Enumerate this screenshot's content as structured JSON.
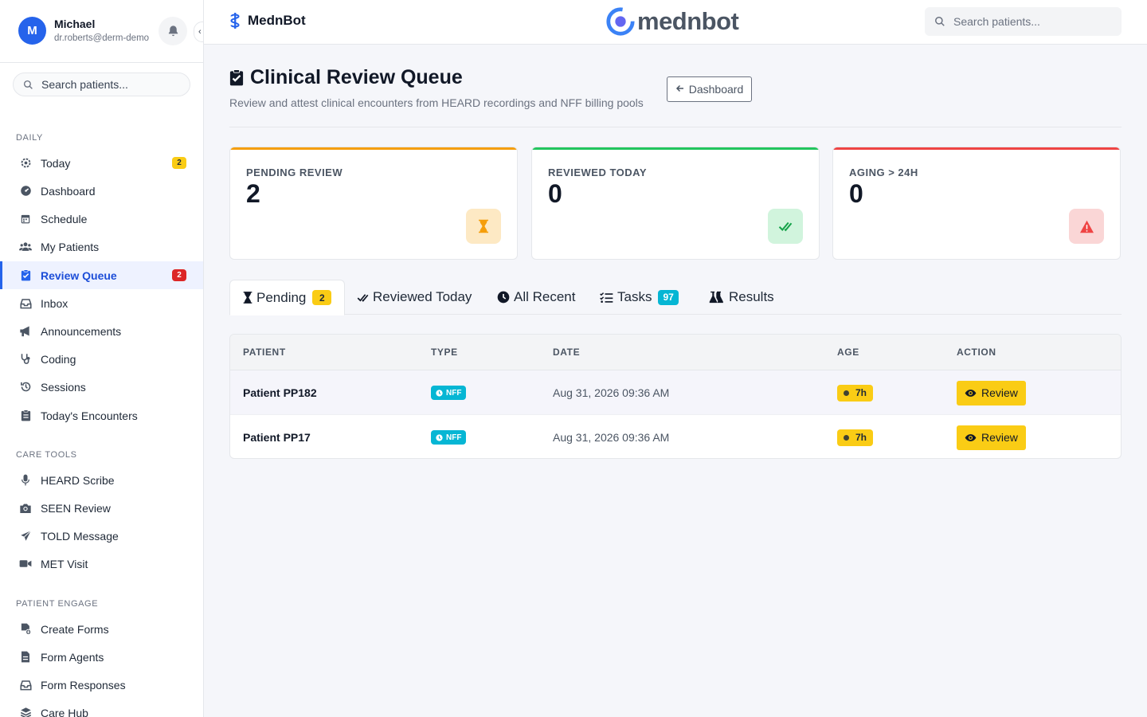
{
  "user": {
    "initial": "M",
    "name": "Michael",
    "email": "dr.roberts@derm-demo"
  },
  "sidebar": {
    "search_placeholder": "Search patients...",
    "sections": {
      "daily": "DAILY",
      "care_tools": "CARE TOOLS",
      "patient_engage": "PATIENT ENGAGE"
    },
    "daily_items": [
      {
        "label": "Today",
        "icon": "gear-icon",
        "badge": "2"
      },
      {
        "label": "Dashboard",
        "icon": "gauge-icon"
      },
      {
        "label": "Schedule",
        "icon": "calendar-icon"
      },
      {
        "label": "My Patients",
        "icon": "users-icon"
      },
      {
        "label": "Review Queue",
        "icon": "clipboard-check-icon",
        "badge": "2",
        "active": true
      },
      {
        "label": "Inbox",
        "icon": "inbox-icon"
      },
      {
        "label": "Announcements",
        "icon": "megaphone-icon"
      },
      {
        "label": "Coding",
        "icon": "stethoscope-icon"
      },
      {
        "label": "Sessions",
        "icon": "history-icon"
      },
      {
        "label": "Today's Encounters",
        "icon": "clipboard-icon"
      }
    ],
    "care_items": [
      {
        "label": "HEARD Scribe",
        "icon": "microphone-icon"
      },
      {
        "label": "SEEN Review",
        "icon": "camera-icon"
      },
      {
        "label": "TOLD Message",
        "icon": "paper-plane-icon"
      },
      {
        "label": "MET Visit",
        "icon": "video-icon"
      }
    ],
    "engage_items": [
      {
        "label": "Create Forms",
        "icon": "file-plus-icon"
      },
      {
        "label": "Form Agents",
        "icon": "file-icon"
      },
      {
        "label": "Form Responses",
        "icon": "inbox-icon"
      },
      {
        "label": "Care Hub",
        "icon": "layers-icon"
      }
    ]
  },
  "topbar": {
    "brand": "MednBot",
    "logo_text": "mednbot",
    "search_placeholder": "Search patients..."
  },
  "page": {
    "title": "Clinical Review Queue",
    "subtitle": "Review and attest clinical encounters from HEARD recordings and NFF billing pools",
    "dashboard_button": "Dashboard"
  },
  "stats": [
    {
      "label": "PENDING REVIEW",
      "value": "2",
      "color": "#f59e0b",
      "icon": "hourglass-icon"
    },
    {
      "label": "REVIEWED TODAY",
      "value": "0",
      "color": "#22c55e",
      "icon": "check-double-icon"
    },
    {
      "label": "AGING > 24H",
      "value": "0",
      "color": "#ef4444",
      "icon": "warning-icon"
    }
  ],
  "tabs": [
    {
      "label": "Pending",
      "badge": "2",
      "icon": "hourglass-icon"
    },
    {
      "label": "Reviewed Today",
      "icon": "check-double-icon"
    },
    {
      "label": "All Recent",
      "icon": "clock-icon"
    },
    {
      "label": "Tasks",
      "badge": "97",
      "icon": "tasks-icon"
    },
    {
      "label": "Results",
      "icon": "flask-icon"
    }
  ],
  "table": {
    "headers": [
      "PATIENT",
      "TYPE",
      "DATE",
      "AGE",
      "ACTION"
    ],
    "rows": [
      {
        "patient": "Patient PP182",
        "type": "NFF",
        "date": "Aug 31, 2026 09:36 AM",
        "age": "7h",
        "action": "Review"
      },
      {
        "patient": "Patient PP17",
        "type": "NFF",
        "date": "Aug 31, 2026 09:36 AM",
        "age": "7h",
        "action": "Review"
      }
    ]
  }
}
